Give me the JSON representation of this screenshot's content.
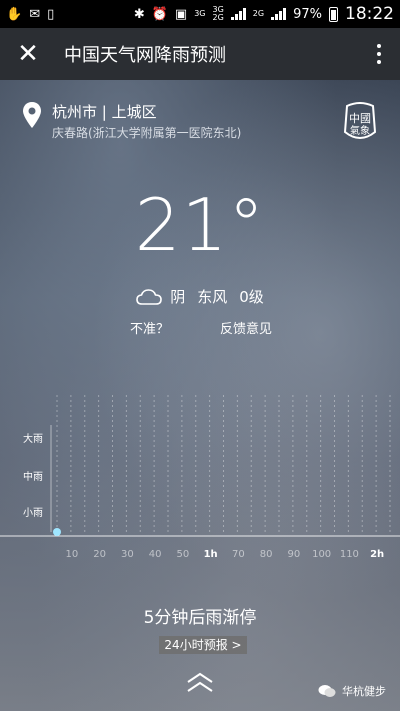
{
  "status": {
    "time": "18:22",
    "battery": "97%",
    "net_a_top": "3G",
    "net_b_top": "3G",
    "net_b_bottom": "2G",
    "net_c": "2G"
  },
  "appbar": {
    "title": "中国天气网降雨预测"
  },
  "location": {
    "city": "杭州市 | 上城区",
    "address": "庆春路(浙江大学附属第一医院东北)"
  },
  "weather": {
    "temperature": "21°",
    "condition": "阴",
    "wind": "东风",
    "wind_level": "0级"
  },
  "links": {
    "inaccurate": "不准？",
    "feedback": "反馈意见"
  },
  "chart_data": {
    "type": "line",
    "y_categories": [
      "小雨",
      "中雨",
      "大雨"
    ],
    "x_ticks": [
      "10",
      "20",
      "30",
      "40",
      "50",
      "1h",
      "70",
      "80",
      "90",
      "100",
      "110",
      "2h"
    ],
    "x_unit_note": "",
    "values": [
      0
    ]
  },
  "summary": "5分钟后雨渐停",
  "forecast_button": "24小时预报 >",
  "brand": "华杭健步"
}
